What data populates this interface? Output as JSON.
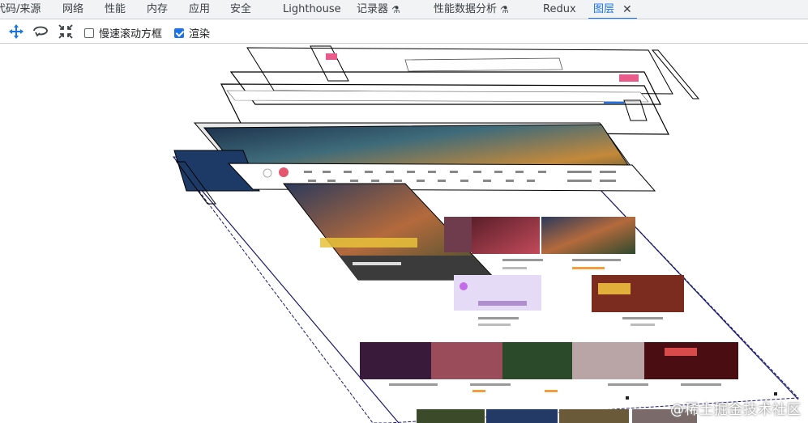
{
  "tabs": [
    {
      "label": "代码/来源",
      "flask": false,
      "active": false
    },
    {
      "label": "网络",
      "flask": false,
      "active": false
    },
    {
      "label": "性能",
      "flask": false,
      "active": false
    },
    {
      "label": "内存",
      "flask": false,
      "active": false
    },
    {
      "label": "应用",
      "flask": false,
      "active": false
    },
    {
      "label": "安全",
      "flask": false,
      "active": false
    },
    {
      "label": "Lighthouse",
      "flask": false,
      "active": false
    },
    {
      "label": "记录器",
      "flask": true,
      "active": false
    },
    {
      "label": "性能数据分析",
      "flask": true,
      "active": false
    },
    {
      "label": "Redux",
      "flask": false,
      "active": false
    },
    {
      "label": "图层",
      "flask": false,
      "active": true
    }
  ],
  "toolbar": {
    "pan_icon": "move-arrows-icon",
    "rotate_icon": "rotate-icon",
    "reset_icon": "reset-view-icon",
    "slow_scroll_label": "慢速滚动方框",
    "slow_scroll_checked": false,
    "paint_label": "渲染",
    "paint_checked": true
  },
  "watermark": "@稀土掘金技术社区",
  "colors": {
    "accent": "#1a73e8",
    "tabbar_bg": "#f1f3f4",
    "layer_outline": "#000000",
    "page_outline": "#1a1a6e"
  }
}
